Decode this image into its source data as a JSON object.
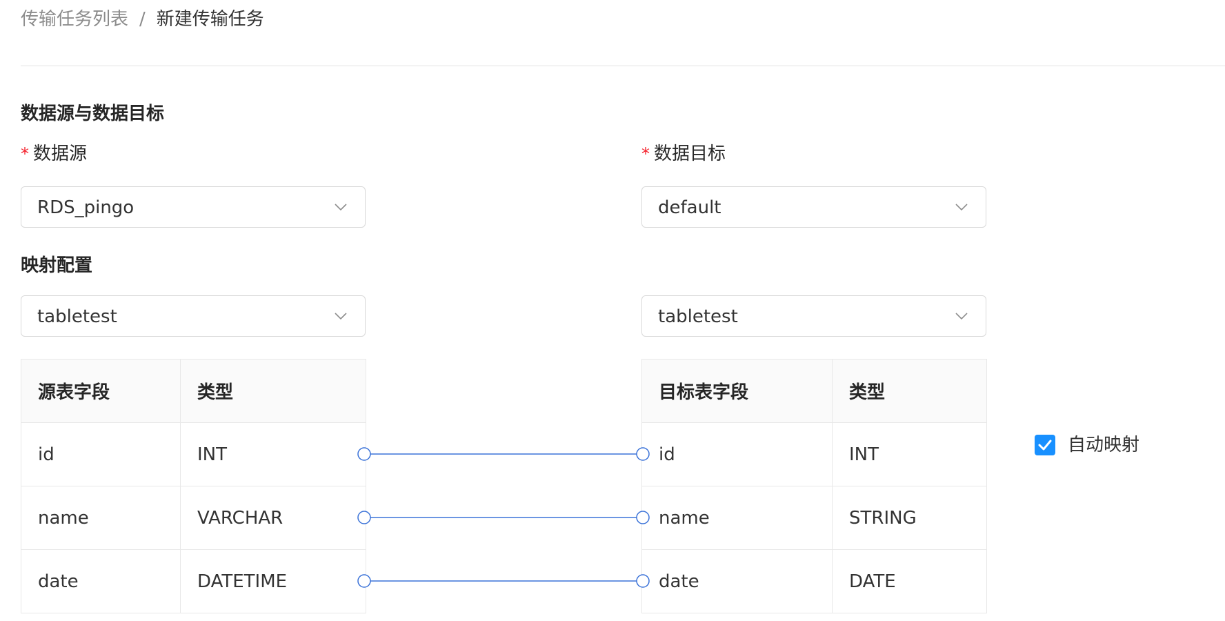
{
  "breadcrumb": {
    "parent": "传输任务列表",
    "separator": "/",
    "current": "新建传输任务"
  },
  "section_source_target": {
    "title": "数据源与数据目标",
    "source_label": "数据源",
    "target_label": "数据目标",
    "required_mark": "*",
    "source_value": "RDS_pingo",
    "target_value": "default"
  },
  "mapping": {
    "title": "映射配置",
    "source_table": "tabletest",
    "target_table": "tabletest",
    "source_headers": [
      "源表字段",
      "类型"
    ],
    "target_headers": [
      "目标表字段",
      "类型"
    ],
    "source_rows": [
      {
        "field": "id",
        "type": "INT"
      },
      {
        "field": "name",
        "type": "VARCHAR"
      },
      {
        "field": "date",
        "type": "DATETIME"
      }
    ],
    "target_rows": [
      {
        "field": "id",
        "type": "INT"
      },
      {
        "field": "name",
        "type": "STRING"
      },
      {
        "field": "date",
        "type": "DATE"
      }
    ],
    "auto_map_label": "自动映射",
    "auto_map_checked": true
  },
  "colors": {
    "accent": "#1890ff",
    "connector": "#3a72d8",
    "required": "#f5222d"
  },
  "icons": [
    "chevron-down-icon",
    "check-icon"
  ]
}
